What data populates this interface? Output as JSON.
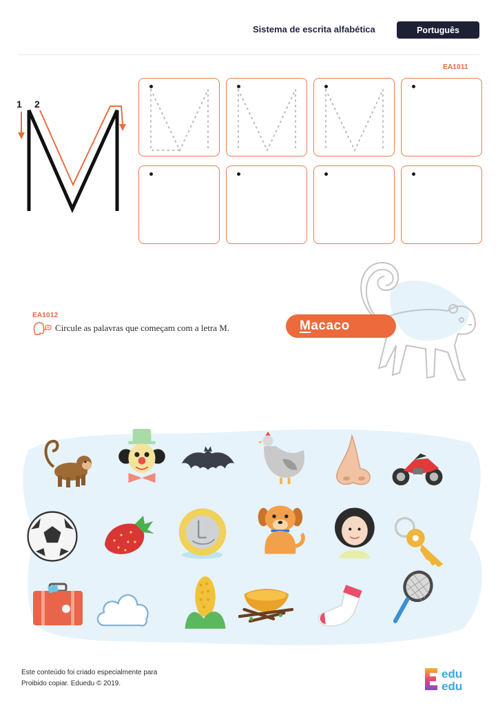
{
  "header": {
    "title": "Sistema de escrita alfabética",
    "language": "Português"
  },
  "exercise1": {
    "code": "EA1011",
    "letter": "M",
    "stroke_numbers": [
      "1",
      "2"
    ]
  },
  "exercise2": {
    "code": "EA1012",
    "instruction": "Circule as palavras que começam com a letra M.",
    "example_word_first": "M",
    "example_word_rest": "acaco"
  },
  "pictures": [
    "monkey",
    "clown",
    "bat",
    "hen",
    "nose",
    "motorcycle",
    "soccer-ball",
    "strawberry",
    "coin",
    "dog",
    "woman",
    "key",
    "suitcase",
    "cloud",
    "corn",
    "nest",
    "sock",
    "racket"
  ],
  "footer": {
    "line1": "Este conteúdo foi criado especialmente para",
    "line2": "Proibido copiar. Eduedu © 2019.",
    "logo_top": "edu",
    "logo_bottom": "edu"
  },
  "colors": {
    "accent": "#ec6a3c",
    "dark": "#1e2036",
    "cloud": "#e6f3fa"
  }
}
